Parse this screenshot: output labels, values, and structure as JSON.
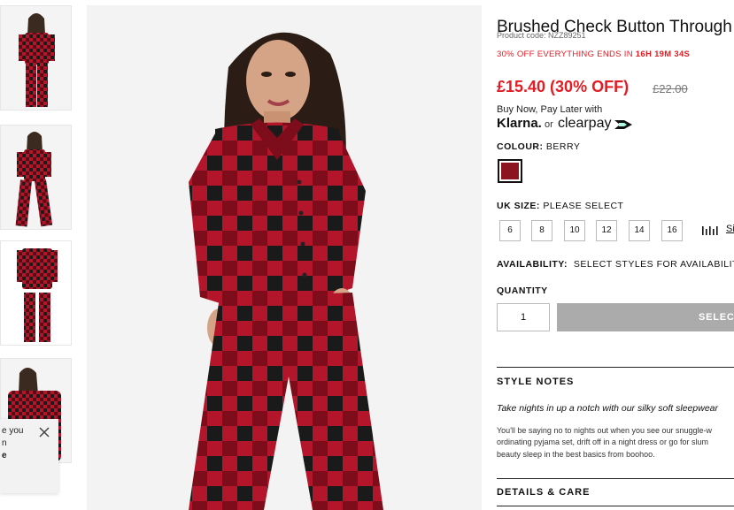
{
  "popup": {
    "line1": "e you",
    "line2": "n",
    "line3": "e"
  },
  "product": {
    "title": "Brushed Check Button Through",
    "code": "Product code: NZZ89251",
    "promo_text": "30% OFF EVERYTHING ENDS IN ",
    "promo_timer": "16H 19M 34S",
    "price": "£15.40 (30% OFF)",
    "old_price": "£22.00",
    "bnpl_text": "Buy Now, Pay Later with",
    "klarna": "Klarna.",
    "or": "or",
    "clearpay": "clearpay"
  },
  "colour": {
    "label": "COLOUR:",
    "value": "BERRY",
    "swatch_color": "#8c1320"
  },
  "size": {
    "label": "UK SIZE:",
    "value": "PLEASE SELECT",
    "options": [
      "6",
      "8",
      "10",
      "12",
      "14",
      "16"
    ],
    "guide_label": "Si"
  },
  "availability": {
    "label": "AVAILABILITY:",
    "value": "SELECT STYLES FOR AVAILABILITY"
  },
  "quantity": {
    "label": "QUANTITY",
    "value": "1",
    "button_label": "SELECT"
  },
  "style_notes": {
    "heading": "STYLE NOTES",
    "lead": "Take nights in up a notch with our silky soft sleepwear",
    "body": [
      "You'll be saying no to nights out when you see our snuggle-w",
      "ordinating pyjama set, drift off in a night dress or go for slum",
      "beauty sleep in the best basics from boohoo."
    ]
  },
  "details": {
    "heading": "DETAILS & CARE"
  },
  "colors": {
    "accent_red": "#e31b23",
    "check_red": "#b3162a",
    "check_black": "#1a1a1a",
    "button_grey": "#ababab"
  }
}
